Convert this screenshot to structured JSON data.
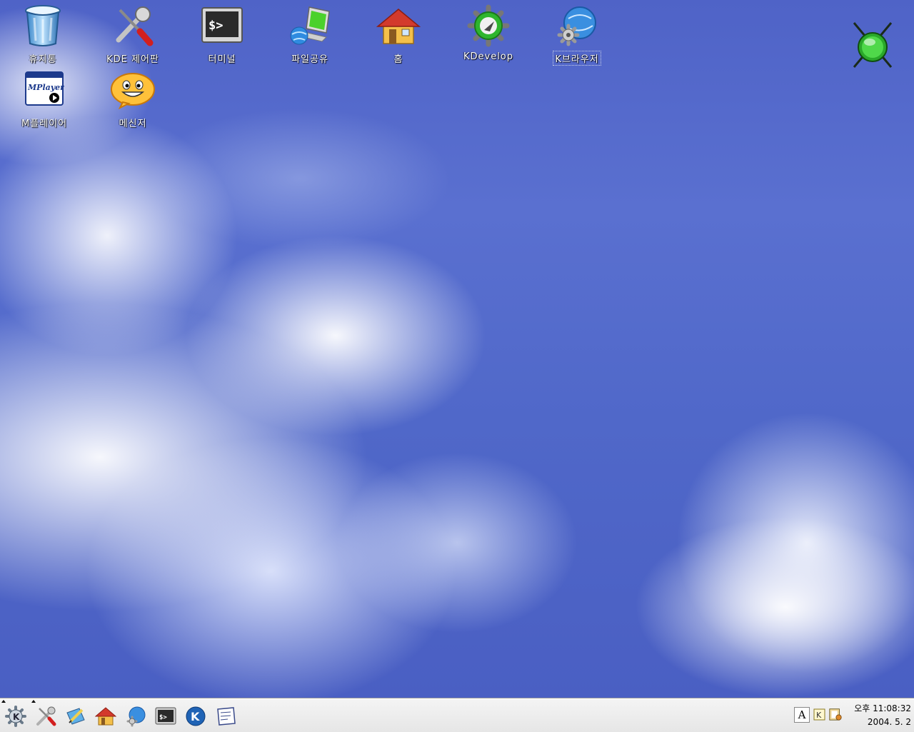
{
  "desktop": {
    "icons": [
      {
        "name": "trash-icon",
        "label": "휴지통"
      },
      {
        "name": "kde-control-center-icon",
        "label": "KDE 제어판"
      },
      {
        "name": "terminal-icon",
        "label": "터미널"
      },
      {
        "name": "file-sharing-icon",
        "label": "파일공유"
      },
      {
        "name": "home-icon",
        "label": "홈"
      },
      {
        "name": "kdevelop-icon",
        "label": "KDevelop"
      },
      {
        "name": "kbrowser-icon",
        "label": "K브라우저"
      },
      {
        "name": "mplayer-icon",
        "label": "M플레이어",
        "logo_text": "MPlayer"
      },
      {
        "name": "messenger-icon",
        "label": "메신저"
      }
    ],
    "status_orb": {
      "name": "green-orb-icon",
      "color": "#3ec83a"
    }
  },
  "taskbar": {
    "launchers": [
      {
        "name": "kde-menu-icon"
      },
      {
        "name": "control-center-launcher-icon"
      },
      {
        "name": "editor-launcher-icon"
      },
      {
        "name": "home-launcher-icon"
      },
      {
        "name": "browser-launcher-icon"
      },
      {
        "name": "terminal-launcher-icon"
      },
      {
        "name": "kde-logo-launcher-icon",
        "text": "K"
      },
      {
        "name": "notes-launcher-icon"
      }
    ],
    "tray": {
      "input_method": "A",
      "kbd_label": "K"
    },
    "clock": {
      "time": "오후 11:08:32",
      "date": "2004. 5. 2"
    }
  }
}
